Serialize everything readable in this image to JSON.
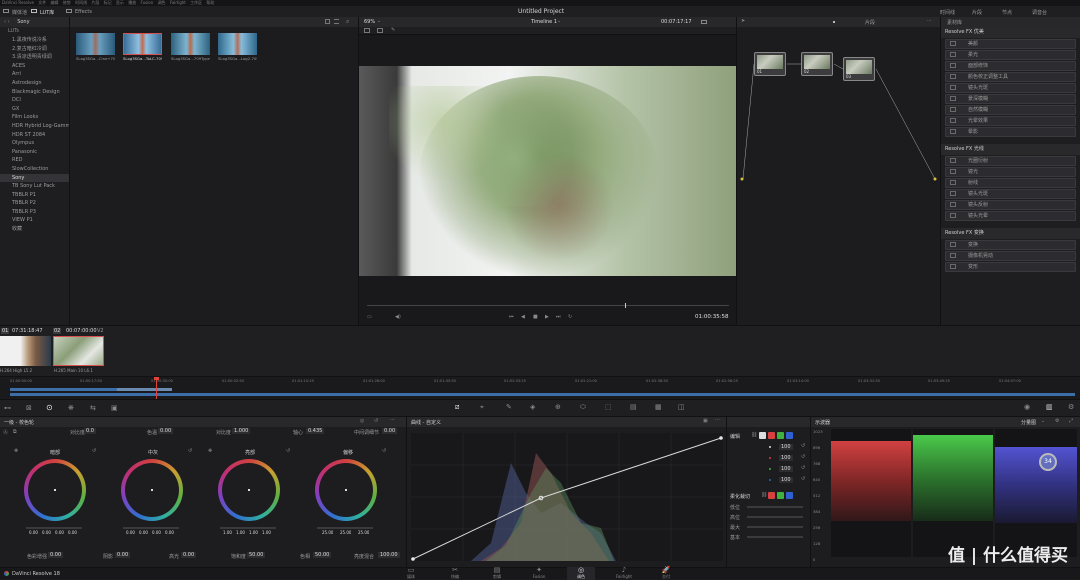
{
  "menubar": {
    "app": "DaVinci Resolve",
    "items": [
      "文件",
      "编辑",
      "修剪",
      "时间线",
      "片段",
      "标记",
      "显示",
      "播放",
      "Fusion",
      "调色",
      "Fairlight",
      "工作区",
      "帮助"
    ]
  },
  "toolbar": {
    "media_pool": "媒体池",
    "lut": "LUT库",
    "effects": "Effects",
    "project_title": "Untitled Project",
    "timeline_name": "Timeline 1",
    "timecode_top": "00:07:17:17",
    "zoom": "69%",
    "clip_mode": "片段",
    "right_items": [
      "时间线",
      "片段",
      "节点",
      "特效库",
      "光照",
      "调音台"
    ]
  },
  "lut_browser": {
    "current": "Sony",
    "root": "LUTs",
    "items": [
      "1.黑夜传说冷系",
      "2.复古暗红冷调",
      "3.清凉透明青绿调",
      "ACES",
      "Arri",
      "Astrodesign",
      "Blackmagic Design",
      "DCI",
      "GX",
      "Film Looks",
      "HDR Hybrid Log-Gamma",
      "HDR ST 2084",
      "Olympus",
      "Panasonic",
      "RED",
      "SlowCollection",
      "Sony",
      "TB Sony Lut Pack",
      "TBBLR P1",
      "TBBLR P2",
      "TBBLR P3",
      "VIEW P1",
      "收藏"
    ],
    "selected": "Sony",
    "thumbs": [
      "SLog3SGa...Cine+709",
      "SLog3SGa...ToLC-709",
      "SLog3SGa...709Type",
      "SLog3SGa...Log2-709"
    ]
  },
  "viewer": {
    "timecode": "01:00:35:58"
  },
  "nodes": {
    "labels": [
      "01",
      "02",
      "03"
    ]
  },
  "fx_library": {
    "tab": "素材库",
    "sections": [
      {
        "title": "Resolve FX 优美",
        "items": [
          "美颜",
          "柔光",
          "面部修饰",
          "颜色校正调整工具",
          "镜头光斑",
          "景深模糊",
          "自然模糊",
          "光晕效果",
          "晕影"
        ]
      },
      {
        "title": "Resolve FX 光线",
        "items": [
          "光圈衍射",
          "镜光",
          "射线",
          "镜头光斑",
          "镜头反射",
          "镜头光晕"
        ]
      },
      {
        "title": "Resolve FX 变换",
        "items": [
          "变换",
          "摄像机晃动",
          "变形"
        ]
      }
    ]
  },
  "timeline_strip": {
    "clip1_tc": "07:31:18:47",
    "clip2_tc": "00:07:00:00",
    "track_labels": [
      "01",
      "02",
      "V2"
    ],
    "clip1_label": "H.264 High L5.2",
    "clip2_label": "H.265 Main 10 L6.1",
    "ruler": [
      "01:00:00:00",
      "01:00:17:50",
      "01:00:35:00",
      "01:00:52:50",
      "01:01:10:25",
      "01:01:28:00",
      "01:01:45:50",
      "01:02:03:25",
      "01:02:21:00",
      "01:02:38:50",
      "01:02:56:25",
      "01:03:14:00",
      "01:03:31:50",
      "01:03:49:25",
      "01:04:07:00"
    ]
  },
  "color_wheels": {
    "title": "一级 - 校色轮",
    "top_params": [
      {
        "label": "对比度",
        "value": "0.0"
      },
      {
        "label": "色温",
        "value": "0.00"
      },
      {
        "label": "对比度",
        "value": "1.000"
      },
      {
        "label": "轴心",
        "value": "0.435"
      },
      {
        "label": "中间调细节",
        "value": "0.00"
      }
    ],
    "wheels": [
      {
        "name": "暗部",
        "values": [
          "0.00",
          "0.00",
          "0.00",
          "0.00"
        ]
      },
      {
        "name": "中灰",
        "values": [
          "0.00",
          "0.00",
          "0.00",
          "0.00"
        ]
      },
      {
        "name": "亮部",
        "values": [
          "1.00",
          "1.00",
          "1.00",
          "1.00"
        ]
      },
      {
        "name": "偏移",
        "values": [
          "25.00",
          "25.00",
          "25.00"
        ]
      }
    ],
    "bottom_params": [
      {
        "label": "色彩增强",
        "value": "0.00"
      },
      {
        "label": "阴影",
        "value": "0.00"
      },
      {
        "label": "高光",
        "value": "0.00"
      },
      {
        "label": "饱和度",
        "value": "50.00"
      },
      {
        "label": "色相",
        "value": "50.00"
      },
      {
        "label": "亮度混合",
        "value": "100.00"
      }
    ]
  },
  "curves": {
    "title": "曲线 - 自定义",
    "edit_label": "编辑",
    "intensity": [
      "100",
      "100",
      "100",
      "100"
    ],
    "soft_clip_label": "柔化裁切",
    "soft_clip_items": [
      "低位",
      "高位",
      "最大",
      "基本"
    ]
  },
  "scopes": {
    "title": "示波器",
    "mode": "分量图",
    "axis": [
      "1023",
      "896",
      "768",
      "640",
      "512",
      "384",
      "256",
      "128",
      "0"
    ],
    "badge": "34"
  },
  "bottom_bar": {
    "app": "DaVinci Resolve 18",
    "tabs": [
      "媒体",
      "快编",
      "剪辑",
      "Fusion",
      "调色",
      "Fairlight",
      "交付"
    ],
    "active": "调色"
  },
  "watermark": "值 | 什么值得买",
  "colors": {
    "accent": "#e0433a",
    "active_blue": "#2f6fb2",
    "ruler_red": "#e0433a"
  }
}
